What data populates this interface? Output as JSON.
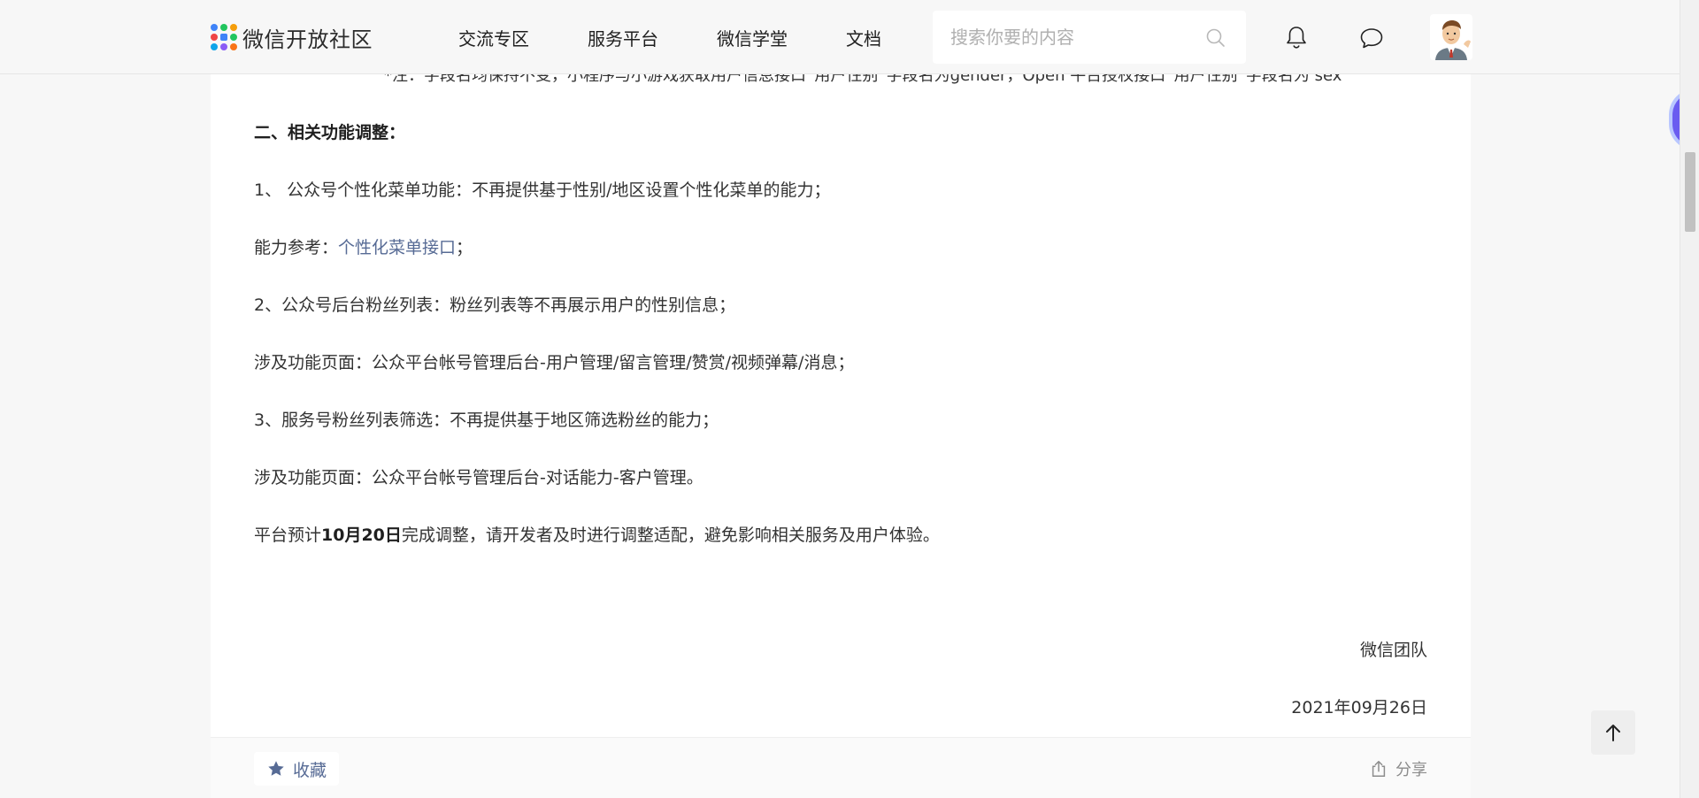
{
  "header": {
    "logo_text": "微信开放社区",
    "nav": [
      "交流专区",
      "服务平台",
      "微信学堂",
      "文档"
    ],
    "search_placeholder": "搜索你要的内容",
    "logo_colors": [
      "#3f83f8",
      "#22c55e",
      "#f59e0b",
      "#ef4444",
      "#3f83f8",
      "#22c55e",
      "#0ea5e9",
      "#8b5cf6",
      "#f97316"
    ]
  },
  "article": {
    "cutoff_note": "*注：字段名均保持不变，小程序与小游戏获取用户信息接口“用户性别”字段名为gender，Open 平台授权接口“用户性别”字段名为 sex",
    "section_title": "二、相关功能调整：",
    "item1": "1、 公众号个性化菜单功能：不再提供基于性别/地区设置个性化菜单的能力；",
    "ref_prefix": "能力参考：",
    "ref_link": "个性化菜单接口",
    "ref_suffix": "；",
    "item2": "2、公众号后台粉丝列表：粉丝列表等不再展示用户的性别信息；",
    "item2_pages": "涉及功能页面：公众平台帐号管理后台-用户管理/留言管理/赞赏/视频弹幕/消息；",
    "item3": "3、服务号粉丝列表筛选：不再提供基于地区筛选粉丝的能力；",
    "item3_pages": "涉及功能页面：公众平台帐号管理后台-对话能力-客户管理。",
    "final_prefix": "平台预计",
    "final_bold": "10月20日",
    "final_suffix": "完成调整，请开发者及时进行调整适配，避免影响相关服务及用户体验。",
    "signature": "微信团队",
    "date": "2021年09月26日"
  },
  "footer": {
    "favorite_label": "收藏",
    "share_label": "分享"
  },
  "icons": {
    "search": "search-icon",
    "bell": "bell-icon",
    "chat": "chat-bubble-icon",
    "star": "star-icon",
    "share": "share-icon",
    "up": "arrow-up-icon"
  }
}
